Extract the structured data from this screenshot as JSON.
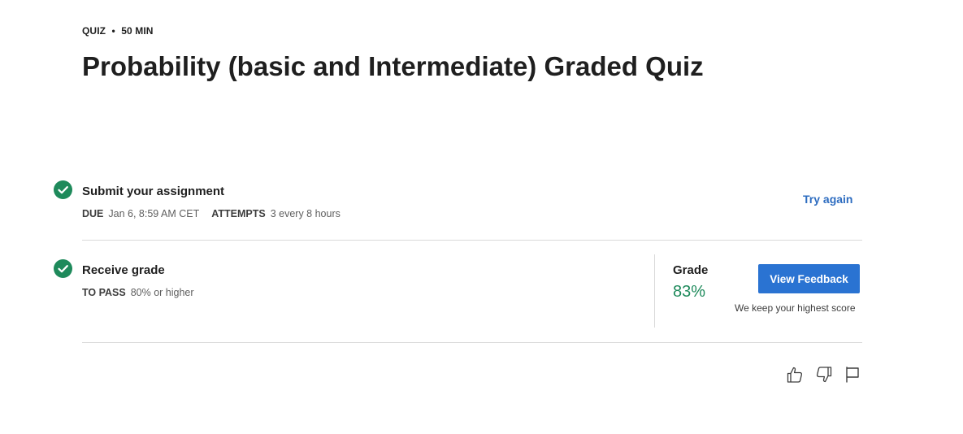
{
  "header": {
    "type_label": "QUIZ",
    "separator": "•",
    "duration": "50 MIN",
    "title": "Probability (basic and Intermediate) Graded Quiz"
  },
  "submit_step": {
    "title": "Submit your assignment",
    "due_key": "DUE",
    "due_value": "Jan 6, 8:59 AM CET",
    "attempts_key": "ATTEMPTS",
    "attempts_value": "3 every 8 hours",
    "action_label": "Try again"
  },
  "grade_step": {
    "title": "Receive grade",
    "pass_key": "TO PASS",
    "pass_value": "80% or higher",
    "grade_label": "Grade",
    "grade_value": "83%",
    "button_label": "View Feedback",
    "note": "We keep your highest score"
  },
  "icons": {
    "check": "check-circle-icon",
    "like": "thumbs-up-icon",
    "dislike": "thumbs-down-icon",
    "report": "flag-icon"
  },
  "colors": {
    "success": "#1e8a5b",
    "link": "#2d6cc0",
    "primary_button": "#2a73d2"
  }
}
